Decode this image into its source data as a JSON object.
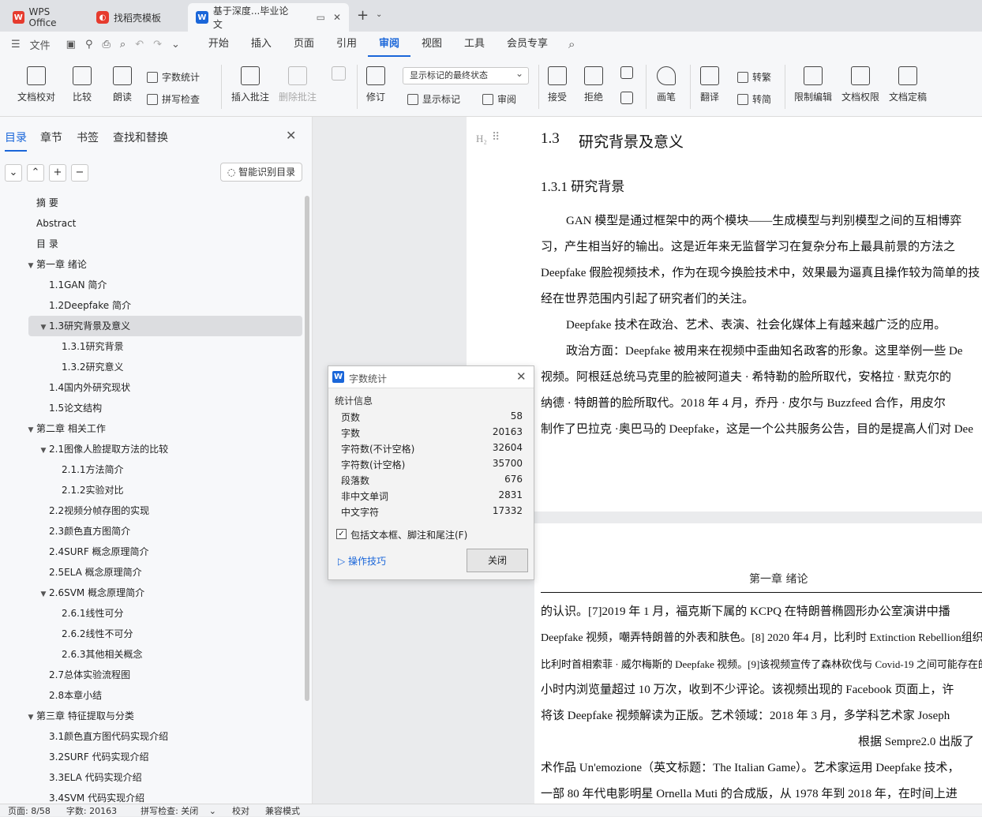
{
  "tabs": [
    {
      "label": "WPS Office",
      "icon": "wps-logo-icon"
    },
    {
      "label": "找稻壳模板",
      "icon": "docer-icon"
    },
    {
      "label": "基于深度...毕业论文",
      "icon": "word-doc-icon"
    }
  ],
  "menu": {
    "file": "文件",
    "items": [
      "开始",
      "插入",
      "页面",
      "引用",
      "审阅",
      "视图",
      "工具",
      "会员专享"
    ],
    "active": "审阅"
  },
  "ribbon": {
    "doc_check": "文档校对",
    "compare": "比较",
    "read_aloud": "朗读",
    "word_count": "字数统计",
    "spell_check": "拼写检查",
    "insert_comment": "插入批注",
    "delete_comment": "删除批注",
    "revise": "修订",
    "show_markup_state": "显示标记的最终状态",
    "show_markup": "显示标记",
    "review": "审阅",
    "accept": "接受",
    "reject": "拒绝",
    "pen": "画笔",
    "translate": "翻译",
    "to_traditional": "转繁",
    "to_simplified": "转简",
    "restrict_edit": "限制编辑",
    "doc_permission": "文档权限",
    "doc_finalize": "文档定稿"
  },
  "nav": {
    "tabs": [
      "目录",
      "章节",
      "书签",
      "查找和替换"
    ],
    "smart_toc": "智能识别目录",
    "toc": [
      {
        "label": "摘  要",
        "level": 0,
        "tw": ""
      },
      {
        "label": "Abstract",
        "level": 0,
        "tw": ""
      },
      {
        "label": "目  录",
        "level": 0,
        "tw": ""
      },
      {
        "label": "第一章 绪论",
        "level": 0,
        "tw": "▼"
      },
      {
        "label": "1.1GAN 简介",
        "level": 1,
        "tw": ""
      },
      {
        "label": "1.2Deepfake 简介",
        "level": 1,
        "tw": ""
      },
      {
        "label": "1.3研究背景及意义",
        "level": 1,
        "tw": "▼",
        "selected": true
      },
      {
        "label": "1.3.1研究背景",
        "level": 2,
        "tw": ""
      },
      {
        "label": "1.3.2研究意义",
        "level": 2,
        "tw": ""
      },
      {
        "label": "1.4国内外研究现状",
        "level": 1,
        "tw": ""
      },
      {
        "label": "1.5论文结构",
        "level": 1,
        "tw": ""
      },
      {
        "label": "第二章 相关工作",
        "level": 0,
        "tw": "▼"
      },
      {
        "label": "2.1图像人脸提取方法的比较",
        "level": 1,
        "tw": "▼"
      },
      {
        "label": "2.1.1方法简介",
        "level": 2,
        "tw": ""
      },
      {
        "label": "2.1.2实验对比",
        "level": 2,
        "tw": ""
      },
      {
        "label": "2.2视频分帧存图的实现",
        "level": 1,
        "tw": ""
      },
      {
        "label": "2.3颜色直方图简介",
        "level": 1,
        "tw": ""
      },
      {
        "label": "2.4SURF 概念原理简介",
        "level": 1,
        "tw": ""
      },
      {
        "label": "2.5ELA 概念原理简介",
        "level": 1,
        "tw": ""
      },
      {
        "label": "2.6SVM 概念原理简介",
        "level": 1,
        "tw": "▼"
      },
      {
        "label": "2.6.1线性可分",
        "level": 2,
        "tw": ""
      },
      {
        "label": "2.6.2线性不可分",
        "level": 2,
        "tw": ""
      },
      {
        "label": "2.6.3其他相关概念",
        "level": 2,
        "tw": ""
      },
      {
        "label": "2.7总体实验流程图",
        "level": 1,
        "tw": ""
      },
      {
        "label": "2.8本章小结",
        "level": 1,
        "tw": ""
      },
      {
        "label": "第三章 特征提取与分类",
        "level": 0,
        "tw": "▼"
      },
      {
        "label": "3.1颜色直方图代码实现介绍",
        "level": 1,
        "tw": ""
      },
      {
        "label": "3.2SURF 代码实现介绍",
        "level": 1,
        "tw": ""
      },
      {
        "label": "3.3ELA 代码实现介绍",
        "level": 1,
        "tw": ""
      },
      {
        "label": "3.4SVM 代码实现介绍",
        "level": 1,
        "tw": ""
      }
    ]
  },
  "doc": {
    "heading_marker": "H₂",
    "h2_num": "1.3",
    "h2_title": "研究背景及意义",
    "h3": "1.3.1 研究背景",
    "p1": [
      "GAN 模型是通过框架中的两个模块——生成模型与判别模型之间的互相博弈",
      "习，产生相当好的输出。这是近年来无监督学习在复杂分布上最具前景的方法之",
      "Deepfake 假脸视频技术，作为在现今换脸技术中，效果最为逼真且操作较为简单的技",
      "经在世界范围内引起了研究者们的关注。"
    ],
    "p2": "Deepfake 技术在政治、艺术、表演、社会化媒体上有越来越广泛的应用。",
    "p3": [
      "政治方面：Deepfake 被用来在视频中歪曲知名政客的形象。这里举例一些  De",
      "视频。阿根廷总统马克里的脸被阿道夫 · 希特勒的脸所取代，安格拉 · 默克尔的",
      "纳德 · 特朗普的脸所取代。2018 年 4 月，乔丹 · 皮尔与  Buzzfeed 合作，用皮尔",
      "制作了巴拉克 ·奥巴马的  Deepfake，这是一个公共服务公告，目的是提高人们对  Dee"
    ],
    "page2_header": "第一章  绪论",
    "page2_lines": [
      "的认识。[7]2019 年  1 月，福克斯下属的  KCPQ 在特朗普椭圆形办公室演讲中播",
      " Deepfake 视频，嘲弄特朗普的外表和肤色。[8] 2020 年4 月，比利时 Extinction Rebellion组织在 Facebook",
      " 比利时首相索菲 · 威尔梅斯的 Deepfake 视频。[9]该视频宣传了森林砍伐与  Covid-19 之间可能存在的联",
      "  小时内浏览量超过  10 万次，收到不少评论。该视频出现的  Facebook 页面上，许",
      "  将该  Deepfake 视频解读为正版。艺术领域：2018 年 3 月，多学科艺术家  Joseph",
      "根据  Sempre2.0 出版了",
      "术作品  Un'emozione（英文标题：The Italian Game）。艺术家运用  Deepfake 技术，",
      "一部  80 年代电影明星  Ornella Muti 的合成版，从  1978 年到  2018 年，在时间上进"
    ]
  },
  "dialog": {
    "title": "字数统计",
    "section": "统计信息",
    "rows": [
      {
        "label": "页数",
        "value": "58"
      },
      {
        "label": "字数",
        "value": "20163"
      },
      {
        "label": "字符数(不计空格)",
        "value": "32604"
      },
      {
        "label": "字符数(计空格)",
        "value": "35700"
      },
      {
        "label": "段落数",
        "value": "676"
      },
      {
        "label": "非中文单词",
        "value": "2831"
      },
      {
        "label": "中文字符",
        "value": "17332"
      }
    ],
    "include_label": "包括文本框、脚注和尾注(F)",
    "include_checked": true,
    "tips": "操作技巧",
    "close": "关闭"
  },
  "status": {
    "page": "页面: 8/58",
    "words": "字数: 20163",
    "spell": "拼写检查: 关闭",
    "proof": "校对",
    "compat": "兼容模式"
  },
  "colors": {
    "accent": "#1a66d9",
    "wps_red": "#e63b2e"
  }
}
